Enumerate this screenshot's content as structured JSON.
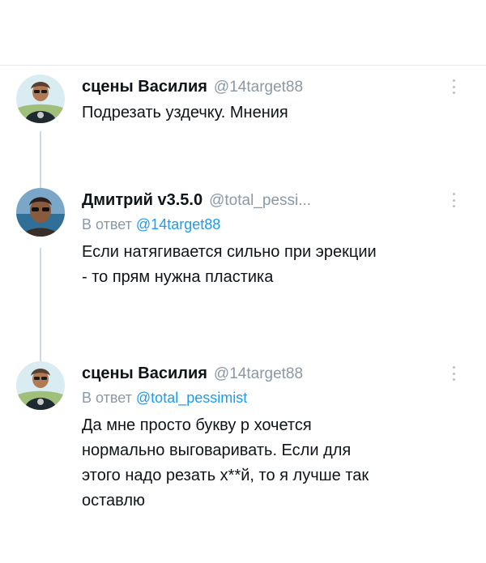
{
  "tweets": [
    {
      "display_name": "сцены Василия",
      "handle": "@14target88",
      "body": "Подрезать уздечку. Мнения",
      "avatar_icon": "avatar-photo-icon"
    },
    {
      "display_name": "Дмитрий v3.5.0",
      "handle": "@total_pessi...",
      "reply_prefix": "В ответ",
      "reply_to": "@14target88",
      "body": "Если натягивается сильно при эрекции\n- то прям нужна пластика",
      "avatar_icon": "avatar-photo-icon"
    },
    {
      "display_name": "сцены Василия",
      "handle": "@14target88",
      "reply_prefix": "В ответ",
      "reply_to": "@total_pessimist",
      "body": "Да мне просто букву р хочется\nнормально выговаривать. Если для\nэтого надо резать х**й, то я лучше так\nоставлю",
      "avatar_icon": "avatar-photo-icon"
    }
  ],
  "icons": {
    "more": "more-vertical-icon",
    "thread": "thread-connector"
  },
  "colors": {
    "text": "#0f1419",
    "secondary": "#8b98a5",
    "link": "#1d9bf0",
    "thread_line": "#cfd9de"
  }
}
